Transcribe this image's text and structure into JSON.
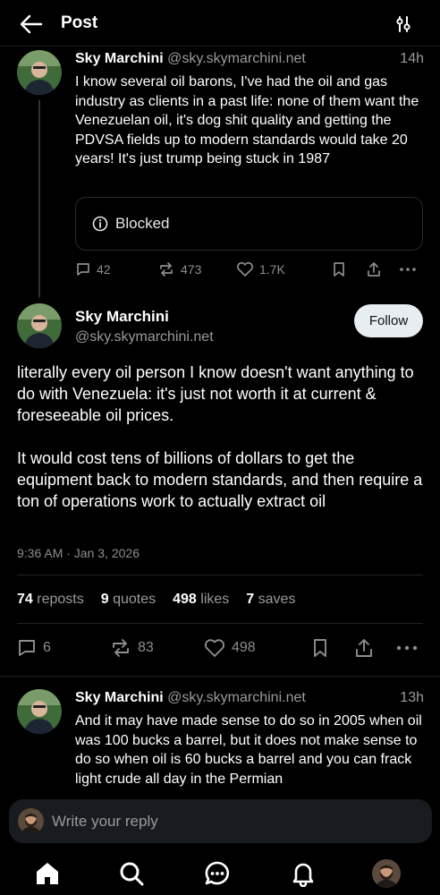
{
  "header": {
    "title": "Post",
    "back_icon": "arrow-left-icon",
    "filter_icon": "sliders-icon"
  },
  "parent_post": {
    "author_name": "Sky Marchini",
    "author_handle": "@sky.skymarchini.net",
    "time": "14h",
    "text": "I know several oil barons, I've had the oil and gas industry as clients in a past life: none of them want the Venezuelan oil, it's dog shit quality and getting the PDVSA fields up to modern standards would take 20 years! It's just trump being stuck in 1987",
    "blocked_label": "Blocked",
    "reply_count": "42",
    "repost_count": "473",
    "like_count": "1.7K"
  },
  "main_post": {
    "author_name": "Sky Marchini",
    "author_handle": "@sky.skymarchini.net",
    "follow_label": "Follow",
    "text": "literally every oil person I know doesn't want anything to do with Venezuela: it's just not worth it at current & foreseeable oil prices.\n\nIt would cost tens of billions of dollars to get the equipment back to modern standards, and then require a ton of operations work to actually extract oil",
    "date": "9:36 AM · Jan 3, 2026",
    "stats": {
      "reposts_value": "74",
      "reposts_label": "reposts",
      "quotes_value": "9",
      "quotes_label": "quotes",
      "likes_value": "498",
      "likes_label": "likes",
      "saves_value": "7",
      "saves_label": "saves"
    },
    "reply_count": "6",
    "repost_count": "83",
    "like_count": "498"
  },
  "reply_post": {
    "author_name": "Sky Marchini",
    "author_handle": "@sky.skymarchini.net",
    "time": "13h",
    "text": "And it may have made sense to do so in 2005 when oil was 100 bucks a barrel, but it does not make sense to do so when oil is 60 bucks a barrel and you can frack light crude all day in the Permian"
  },
  "composer": {
    "placeholder": "Write your reply"
  },
  "nav": {
    "items": [
      "home-icon",
      "search-icon",
      "chat-icon",
      "bell-icon",
      "profile-avatar"
    ]
  },
  "colors": {
    "background": "#000000",
    "muted_text": "#9a9a9a",
    "follow_button_bg": "#e8edf2"
  }
}
